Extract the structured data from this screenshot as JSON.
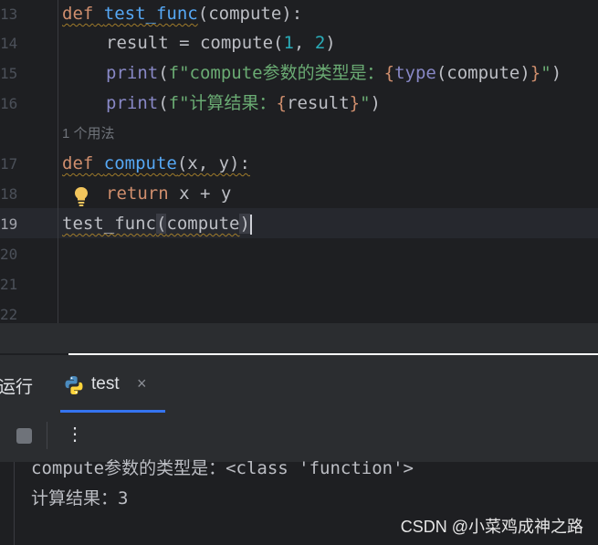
{
  "editor": {
    "line_numbers": [
      "13",
      "14",
      "15",
      "16",
      "17",
      "18",
      "19",
      "20",
      "21",
      "22"
    ],
    "code": {
      "l13": {
        "kw": "def",
        "name": "test_func",
        "open": "(",
        "param": "compute",
        "close": "):"
      },
      "l14": {
        "lhs": "result = compute(",
        "n1": "1",
        "comma": ", ",
        "n2": "2",
        "close": ")"
      },
      "l15": {
        "print": "print",
        "open": "(",
        "str_start": "f\"compute参数的类型是：",
        "brace_open": "{",
        "builtin": "type",
        "inner": "(compute)",
        "brace_close": "}",
        "str_end": "\"",
        "close": ")"
      },
      "l16": {
        "print": "print",
        "open": "(",
        "str_start": "f\"计算结果：",
        "brace_open": "{",
        "var": "result",
        "brace_close": "}",
        "str_end": "\"",
        "close": ")"
      },
      "usages": "1 个用法",
      "l17": {
        "kw": "def",
        "name": "compute",
        "params": "(x, y):"
      },
      "l18": {
        "kw": "return",
        "expr": " x + y"
      },
      "l19": {
        "name": "test_func",
        "open": "(",
        "arg": "compute",
        "close": ")"
      }
    }
  },
  "run_panel": {
    "title": "运行",
    "tab_label": "test",
    "tab_close": "×",
    "more_label": "⋮"
  },
  "console": {
    "lines": [
      "compute参数的类型是：<class 'function'>",
      "计算结果：3"
    ]
  },
  "watermark": "CSDN @小菜鸡成神之路",
  "colors": {
    "keyword": "#cf8e6d",
    "function": "#56a8f5",
    "number": "#2aacb8",
    "string": "#6aab73",
    "tab_accent": "#3574f0"
  }
}
